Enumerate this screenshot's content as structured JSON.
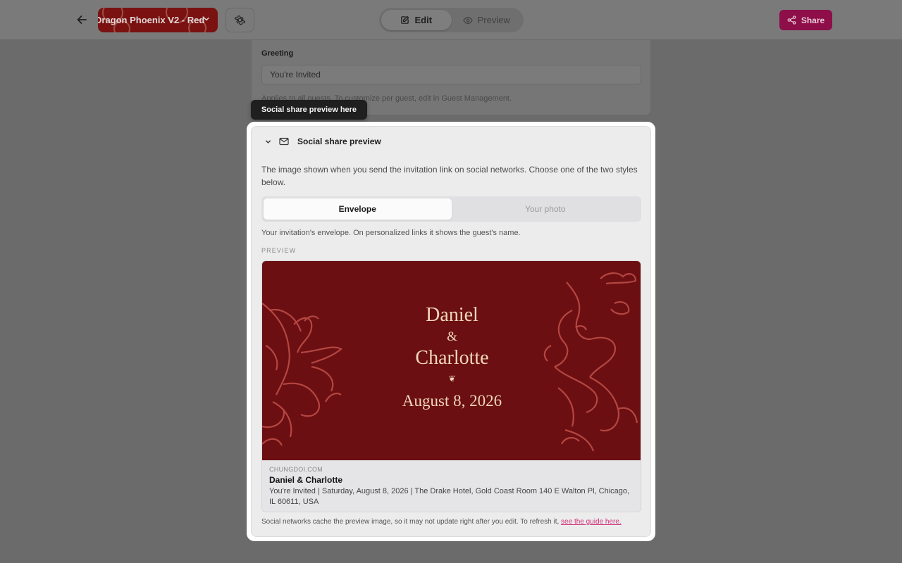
{
  "topbar": {
    "theme_name": "Dragon Phoenix V2 - Red",
    "modes": [
      {
        "label": "Edit",
        "active": true
      },
      {
        "label": "Preview",
        "active": false
      }
    ],
    "share_label": "Share",
    "accent_color": "#d4126e"
  },
  "greeting": {
    "label": "Greeting",
    "value": "You're Invited",
    "help": "Applies to all guests. To customize per guest, edit in Guest Management."
  },
  "tooltip": "Social share preview here",
  "social": {
    "title": "Social share preview",
    "description": "The image shown when you send the invitation link on social networks. Choose one of the two styles below.",
    "styles": [
      {
        "label": "Envelope",
        "active": true
      },
      {
        "label": "Your photo",
        "active": false
      }
    ],
    "style_help": "Your invitation's envelope. On personalized links it shows the guest's name.",
    "preview_label": "PREVIEW",
    "card": {
      "image": {
        "name1": "Daniel",
        "amp": "&",
        "name2": "Charlotte",
        "ornament": "❦",
        "date": "August 8, 2026"
      },
      "domain": "CHUNGDOI.COM",
      "title": "Daniel & Charlotte",
      "description": "You're Invited | Saturday, August 8, 2026 | The Drake Hotel, Gold Coast Room 140 E Walton Pl, Chicago, IL 60611, USA"
    },
    "cache_note": "Social networks cache the preview image, so it may not update right after you edit. To refresh it,",
    "cache_link": "see the guide here."
  }
}
